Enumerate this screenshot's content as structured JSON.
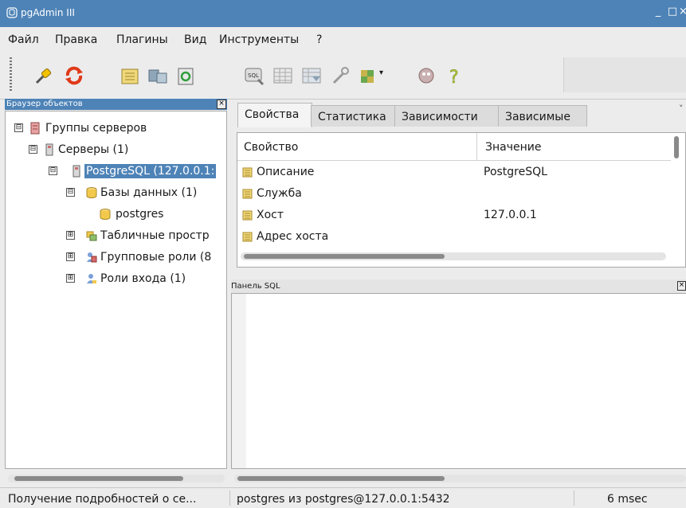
{
  "window": {
    "title": "pgAdmin III",
    "minimize": "_",
    "maximize": "□",
    "close": "×"
  },
  "menu": [
    "Файл",
    "Правка",
    "Плагины",
    "Вид",
    "Инструменты",
    "?"
  ],
  "toolbar": {
    "icons": [
      "connect-icon",
      "refresh-icon",
      "properties-icon",
      "create-object-icon",
      "drop-object-icon",
      "sql-query-icon",
      "view-data-icon",
      "filtered-data-icon",
      "maintenance-icon",
      "plugins-icon",
      "guru-hints-icon",
      "help-icon"
    ],
    "sql_label": "SQL"
  },
  "object_browser": {
    "title": "Браузер объектов",
    "tree": [
      {
        "label": "Группы серверов",
        "icon": "server-groups-icon",
        "expander": "⊟"
      },
      {
        "label": "Серверы (1)",
        "icon": "servers-icon",
        "expander": "⊟"
      },
      {
        "label": "PostgreSQL (127.0.0.1:",
        "icon": "server-icon",
        "expander": "⊟",
        "selected": true
      },
      {
        "label": "Базы данных (1)",
        "icon": "databases-icon",
        "expander": "⊟"
      },
      {
        "label": "postgres",
        "icon": "database-icon",
        "expander": ""
      },
      {
        "label": "Табличные простр",
        "icon": "tablespaces-icon",
        "expander": "⊞"
      },
      {
        "label": "Групповые роли (8",
        "icon": "group-roles-icon",
        "expander": "⊞"
      },
      {
        "label": "Роли входа (1)",
        "icon": "login-roles-icon",
        "expander": "⊞"
      }
    ]
  },
  "tabs": [
    "Свойства",
    "Статистика",
    "Зависимости",
    "Зависимые"
  ],
  "properties": {
    "columns": [
      "Свойство",
      "Значение"
    ],
    "rows": [
      {
        "name": "Описание",
        "value": "PostgreSQL"
      },
      {
        "name": "Служба",
        "value": ""
      },
      {
        "name": "Хост",
        "value": "127.0.0.1"
      },
      {
        "name": "Адрес хоста",
        "value": ""
      }
    ]
  },
  "sql_panel": {
    "title": "Панель SQL"
  },
  "status": {
    "message": "Получение подробностей о се...",
    "connection": "postgres из postgres@127.0.0.1:5432",
    "timing": "6 msec"
  },
  "colors": {
    "accent": "#4e83b7",
    "selection": "#4e83b7"
  }
}
